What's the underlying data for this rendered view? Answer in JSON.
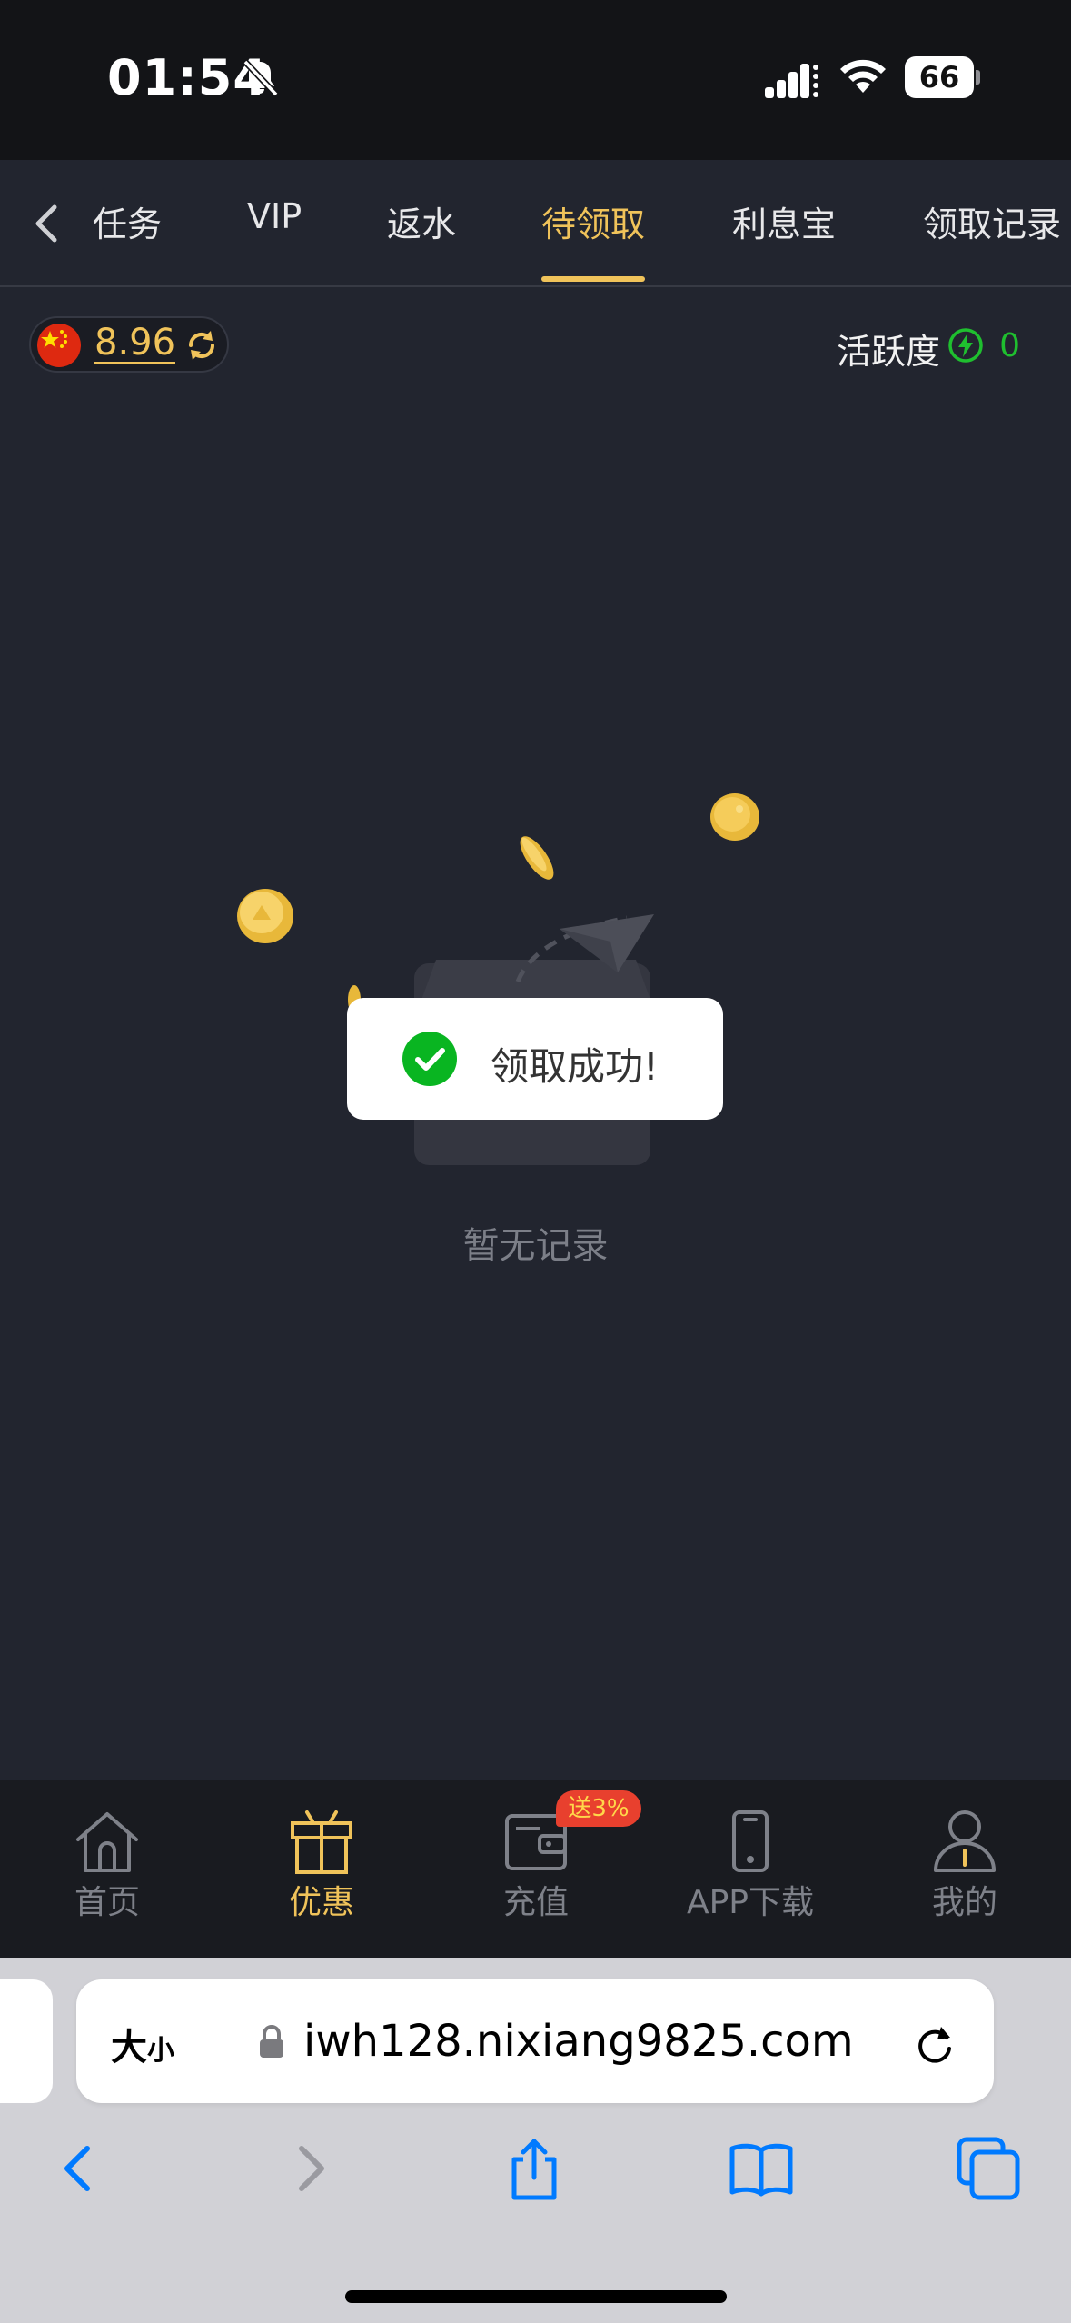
{
  "status_bar": {
    "time": "01:54",
    "battery": "66",
    "icons": [
      "bell-slash-icon",
      "signal-icon",
      "wifi-icon",
      "battery-icon"
    ]
  },
  "tabs": {
    "back_icon": "chevron-left-icon",
    "items": [
      {
        "label": "任务"
      },
      {
        "label": "VIP"
      },
      {
        "label": "返水"
      },
      {
        "label": "待领取"
      },
      {
        "label": "利息宝"
      },
      {
        "label": "领取记录"
      }
    ],
    "active_index": 3,
    "active_color": "#f0c35a"
  },
  "balance": {
    "flag": "china-flag-icon",
    "amount": "8.96",
    "refresh_icon": "refresh-icon"
  },
  "activity": {
    "label": "活跃度",
    "icon": "lightning-icon",
    "value": "0",
    "color": "#1fbf2f"
  },
  "empty_state": {
    "illustration": "empty-box-icon",
    "text": "暂无记录"
  },
  "toast": {
    "icon": "check-circle-icon",
    "message": "领取成功!",
    "icon_color": "#09b521"
  },
  "bottom_nav": {
    "items": [
      {
        "label": "首页",
        "icon": "home-icon"
      },
      {
        "label": "优惠",
        "icon": "gift-icon"
      },
      {
        "label": "充值",
        "icon": "wallet-icon"
      },
      {
        "label": "APP下载",
        "icon": "phone-icon"
      },
      {
        "label": "我的",
        "icon": "user-icon"
      }
    ],
    "active_index": 1,
    "badge": "送3%"
  },
  "browser": {
    "text_size_button": {
      "big": "大",
      "small": "小"
    },
    "url": "iwh128.nixiang9825.com",
    "icons": [
      "lock-icon",
      "reload-icon",
      "back-icon",
      "forward-icon",
      "share-icon",
      "bookmarks-icon",
      "tabs-icon"
    ],
    "accent": "#007aff"
  }
}
